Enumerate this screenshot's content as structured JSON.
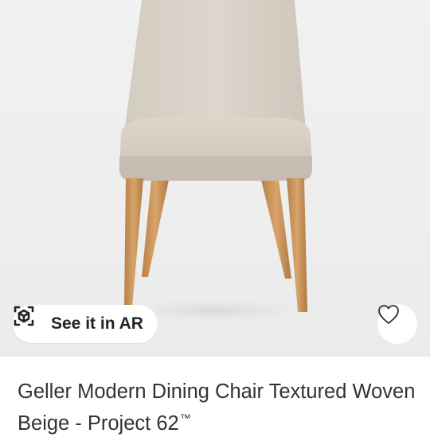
{
  "product": {
    "image_subject": "chair-photo",
    "ar_button_label": "See it in AR",
    "title": "Geller Modern Dining Chair Textured Woven Beige - Project 62",
    "trademark": "™"
  },
  "icons": {
    "ar": "ar-cube-icon",
    "favorite": "heart-outline-icon"
  },
  "colors": {
    "chair_fabric": "#d6cfc4",
    "chair_legs": "#c7935a",
    "background": "#eeeeee",
    "text": "#333333"
  }
}
